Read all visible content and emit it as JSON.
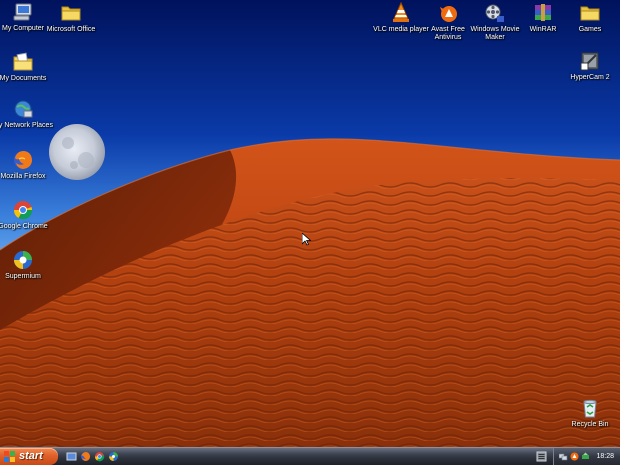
{
  "desktop_icons_left": [
    {
      "label": "My Computer",
      "icon": "computer-icon"
    },
    {
      "label": "My Documents",
      "icon": "documents-folder-icon"
    },
    {
      "label": "My Network Places",
      "icon": "network-places-icon"
    },
    {
      "label": "Mozilla Firefox",
      "icon": "firefox-icon"
    },
    {
      "label": "Google Chrome",
      "icon": "chrome-icon"
    },
    {
      "label": "Supermium",
      "icon": "supermium-icon"
    }
  ],
  "desktop_icons_top": [
    {
      "label": "Microsoft Office",
      "icon": "folder-icon"
    },
    {
      "label": "VLC media player",
      "icon": "vlc-icon"
    },
    {
      "label": "Avast Free Antivirus",
      "icon": "avast-icon"
    },
    {
      "label": "Windows Movie Maker",
      "icon": "movie-maker-icon"
    },
    {
      "label": "WinRAR",
      "icon": "winrar-icon"
    },
    {
      "label": "Games",
      "icon": "folder-icon"
    }
  ],
  "desktop_icons_right": [
    {
      "label": "HyperCam 2",
      "icon": "hypercam-icon"
    },
    {
      "label": "Recycle Bin",
      "icon": "recycle-bin-icon"
    }
  ],
  "taskbar": {
    "start_label": "start",
    "clock": "18:28",
    "quick_launch": [
      "show-desktop-icon",
      "firefox-icon",
      "chrome-icon",
      "supermium-icon"
    ]
  },
  "colors": {
    "sky_top": "#001a6e",
    "sky_bottom": "#7ab0ee",
    "dune": "#b8400f",
    "start_button": "#e0602a",
    "taskbar": "#2e323c"
  }
}
